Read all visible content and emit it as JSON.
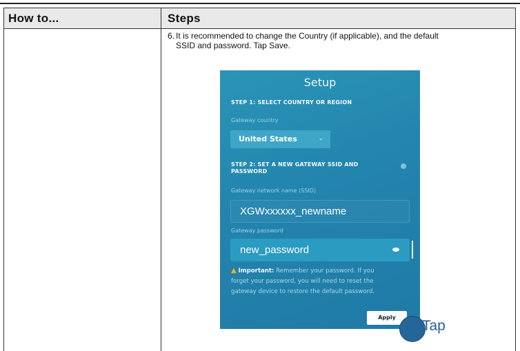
{
  "table": {
    "col1_header": "How to...",
    "col2_header": "Steps"
  },
  "step": {
    "number": "6.",
    "text_line1": "It is recommended to change the Country (if applicable), and the default",
    "text_line2": "SSID and password. Tap Save."
  },
  "screenshot": {
    "title": "Setup",
    "step1_heading": "STEP 1: SELECT COUNTRY OR REGION",
    "country_label": "Gateway country",
    "country_value": "United States",
    "chevron_icon": "chevron-down-icon",
    "step2_heading_line1": "STEP 2: SET A NEW GATEWAY SSID AND",
    "step2_heading_line2": "PASSWORD",
    "ssid_label": "Gateway network name (SSID)",
    "ssid_value": "XGWxxxxxx_newname",
    "password_label": "Gateway password",
    "password_value": "new_password",
    "warning_bold": "Important:",
    "warning_line1": "Remember your password. If you",
    "warning_line2": "forget your password, you will need to reset the",
    "warning_line3": "gateway device to restore the default password.",
    "apply_label": "Apply"
  },
  "callout": {
    "tap_label": "Tap"
  },
  "colors": {
    "screen_bg": "#2384ad",
    "warning_icon": "#f2b21a",
    "callout": "#24659a"
  }
}
